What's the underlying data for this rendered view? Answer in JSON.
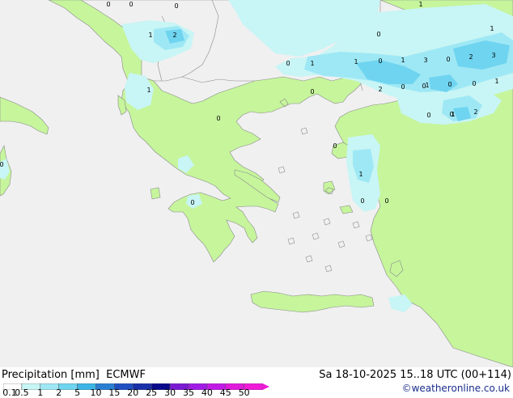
{
  "title": {
    "product": "Precipitation [mm]",
    "model": "ECMWF",
    "valid_time": "Sa 18-10-2025 15..18 UTC (00+114)",
    "credit": "©weatheronline.co.uk"
  },
  "legend": {
    "labels": [
      "0.1",
      "0.5",
      "1",
      "2",
      "5",
      "10",
      "15",
      "20",
      "25",
      "30",
      "35",
      "40",
      "45",
      "50"
    ],
    "colors": [
      "#ffffff",
      "#c8f5f5",
      "#9ee8f5",
      "#6fd4f0",
      "#3cb4e6",
      "#2a7fd2",
      "#1f4fc2",
      "#1a30a8",
      "#0a0a8c",
      "#7a1ad2",
      "#a11ae6",
      "#c21ae6",
      "#e01adb",
      "#f01ad8"
    ]
  },
  "colors": {
    "sea": "#f0f0f0",
    "land": "#c6f59c",
    "precip_light": "#c8f5f5",
    "precip_medium": "#9ee8f5",
    "precip_heavy": "#6fd4f0",
    "coastline": "#8a8a8a"
  },
  "precip_values": [
    "0",
    "0",
    "0",
    "1",
    "1",
    "2",
    "0",
    "0",
    "1",
    "1",
    "0",
    "1",
    "3",
    "0",
    "2",
    "3",
    "1",
    "1",
    "0",
    "2",
    "0",
    "0",
    "1",
    "0",
    "0",
    "1",
    "0",
    "0",
    "0",
    "1",
    "2",
    "0",
    "1",
    "0",
    "0",
    "0",
    "0"
  ]
}
